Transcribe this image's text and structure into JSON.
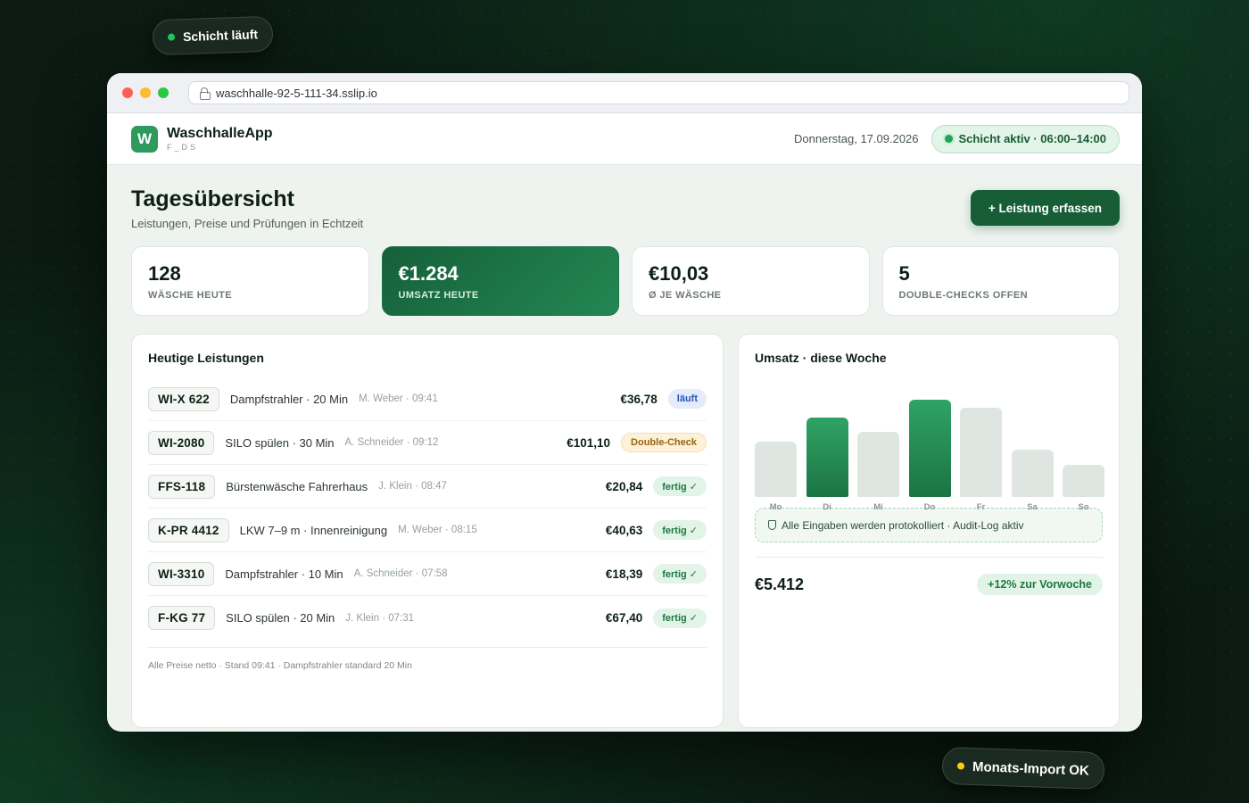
{
  "floating": {
    "shift_label": "Schicht läuft",
    "import_label": "Monats-Import OK"
  },
  "browser": {
    "url": "waschhalle-92-5-111-34.sslip.io"
  },
  "header": {
    "logo_letter": "W",
    "app_name": "WaschhalleApp",
    "app_sub": "F_DS",
    "date": "Donnerstag, 17.09.2026",
    "shift_badge": "Schicht aktiv · 06:00–14:00"
  },
  "page": {
    "title": "Tagesübersicht",
    "subtitle": "Leistungen, Preise und Prüfungen in Echtzeit",
    "add_button": "+ Leistung erfassen"
  },
  "stats": [
    {
      "value": "128",
      "label": "WÄSCHE HEUTE"
    },
    {
      "value": "€1.284",
      "label": "UMSATZ HEUTE"
    },
    {
      "value": "€10,03",
      "label": "Ø JE WÄSCHE"
    },
    {
      "value": "5",
      "label": "DOUBLE-CHECKS OFFEN"
    }
  ],
  "services": {
    "title": "Heutige Leistungen",
    "rows": [
      {
        "plate": "WI-X 622",
        "service": "Dampfstrahler · 20 Min",
        "meta": "M. Weber · 09:41",
        "price": "€36,78",
        "status": "läuft",
        "status_kind": "running"
      },
      {
        "plate": "WI-2080",
        "service": "SILO spülen · 30 Min",
        "meta": "A. Schneider · 09:12",
        "price": "€101,10",
        "status": "Double-Check",
        "status_kind": "check"
      },
      {
        "plate": "FFS-118",
        "service": "Bürstenwäsche Fahrerhaus",
        "meta": "J. Klein · 08:47",
        "price": "€20,84",
        "status": "fertig ✓",
        "status_kind": "done"
      },
      {
        "plate": "K-PR 4412",
        "service": "LKW 7–9 m · Innenreinigung",
        "meta": "M. Weber · 08:15",
        "price": "€40,63",
        "status": "fertig ✓",
        "status_kind": "done"
      },
      {
        "plate": "WI-3310",
        "service": "Dampfstrahler · 10 Min",
        "meta": "A. Schneider · 07:58",
        "price": "€18,39",
        "status": "fertig ✓",
        "status_kind": "done"
      },
      {
        "plate": "F-KG 77",
        "service": "SILO spülen · 20 Min",
        "meta": "J. Klein · 07:31",
        "price": "€67,40",
        "status": "fertig ✓",
        "status_kind": "done"
      }
    ],
    "footnote": "Alle Preise netto · Stand 09:41 · Dampfstrahler standard 20 Min"
  },
  "revenue": {
    "title": "Umsatz · diese Woche",
    "audit_text": "Alle Eingaben werden protokolliert · Audit-Log aktiv",
    "total": "€5.412",
    "trend": "+12% zur Vorwoche"
  },
  "colors": {
    "accent": "#175e37",
    "bar_highlight": "#2fa364",
    "bar_muted": "#dfe6e1",
    "status_running": "#2a55b8",
    "status_check": "#9a6410",
    "status_done": "#1b7a40",
    "dot_green": "#22c55e",
    "dot_yellow": "#facc15"
  },
  "chart_data": {
    "type": "bar",
    "categories": [
      "Mo",
      "Di",
      "Mi",
      "Do",
      "Fr",
      "Sa",
      "So"
    ],
    "values": [
      0.56,
      0.81,
      0.66,
      0.99,
      0.91,
      0.48,
      0.33
    ],
    "value_unit": "fraction of tallest visible bar (no axis printed)",
    "highlighted": [
      "Di",
      "Do"
    ],
    "title": "Umsatz · diese Woche",
    "xlabel": "",
    "ylabel": "",
    "grid": false,
    "legend": "none"
  }
}
